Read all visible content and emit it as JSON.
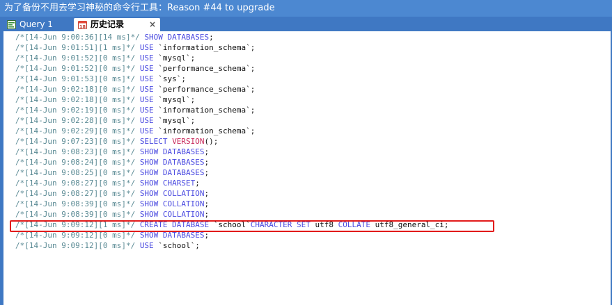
{
  "window": {
    "title": "为了备份不用去学习神秘的命令行工具：Reason #44 to upgrade"
  },
  "tabs": [
    {
      "label": "Query 1",
      "icon": "query-icon",
      "active": false
    },
    {
      "label": "历史记录",
      "icon": "calendar-icon",
      "icon_text": "18",
      "active": true
    }
  ],
  "add_tab_label": "+",
  "close_tab_label": "×",
  "history": [
    {
      "comment": "/*[14-Jun 9:00:36][14 ms]*/",
      "sql": [
        {
          "t": "k",
          "v": "SHOW DATABASES"
        },
        {
          "t": "s",
          "v": ";"
        }
      ]
    },
    {
      "comment": "/*[14-Jun 9:01:51][1 ms]*/",
      "sql": [
        {
          "t": "k",
          "v": "USE"
        },
        {
          "t": "s",
          "v": " `information_schema`;"
        }
      ]
    },
    {
      "comment": "/*[14-Jun 9:01:52][0 ms]*/",
      "sql": [
        {
          "t": "k",
          "v": "USE"
        },
        {
          "t": "s",
          "v": " `mysql`;"
        }
      ]
    },
    {
      "comment": "/*[14-Jun 9:01:52][0 ms]*/",
      "sql": [
        {
          "t": "k",
          "v": "USE"
        },
        {
          "t": "s",
          "v": " `performance_schema`;"
        }
      ]
    },
    {
      "comment": "/*[14-Jun 9:01:53][0 ms]*/",
      "sql": [
        {
          "t": "k",
          "v": "USE"
        },
        {
          "t": "s",
          "v": " `sys`;"
        }
      ]
    },
    {
      "comment": "/*[14-Jun 9:02:18][0 ms]*/",
      "sql": [
        {
          "t": "k",
          "v": "USE"
        },
        {
          "t": "s",
          "v": " `performance_schema`;"
        }
      ]
    },
    {
      "comment": "/*[14-Jun 9:02:18][0 ms]*/",
      "sql": [
        {
          "t": "k",
          "v": "USE"
        },
        {
          "t": "s",
          "v": " `mysql`;"
        }
      ]
    },
    {
      "comment": "/*[14-Jun 9:02:19][0 ms]*/",
      "sql": [
        {
          "t": "k",
          "v": "USE"
        },
        {
          "t": "s",
          "v": " `information_schema`;"
        }
      ]
    },
    {
      "comment": "/*[14-Jun 9:02:28][0 ms]*/",
      "sql": [
        {
          "t": "k",
          "v": "USE"
        },
        {
          "t": "s",
          "v": " `mysql`;"
        }
      ]
    },
    {
      "comment": "/*[14-Jun 9:02:29][0 ms]*/",
      "sql": [
        {
          "t": "k",
          "v": "USE"
        },
        {
          "t": "s",
          "v": " `information_schema`;"
        }
      ]
    },
    {
      "comment": "/*[14-Jun 9:07:23][0 ms]*/",
      "sql": [
        {
          "t": "k",
          "v": "SELECT"
        },
        {
          "t": "s",
          "v": " "
        },
        {
          "t": "f",
          "v": "VERSION"
        },
        {
          "t": "s",
          "v": "();"
        }
      ]
    },
    {
      "comment": "/*[14-Jun 9:08:23][0 ms]*/",
      "sql": [
        {
          "t": "k",
          "v": "SHOW DATABASES"
        },
        {
          "t": "s",
          "v": ";"
        }
      ]
    },
    {
      "comment": "/*[14-Jun 9:08:24][0 ms]*/",
      "sql": [
        {
          "t": "k",
          "v": "SHOW DATABASES"
        },
        {
          "t": "s",
          "v": ";"
        }
      ]
    },
    {
      "comment": "/*[14-Jun 9:08:25][0 ms]*/",
      "sql": [
        {
          "t": "k",
          "v": "SHOW DATABASES"
        },
        {
          "t": "s",
          "v": ";"
        }
      ]
    },
    {
      "comment": "/*[14-Jun 9:08:27][0 ms]*/",
      "sql": [
        {
          "t": "k",
          "v": "SHOW CHARSET"
        },
        {
          "t": "s",
          "v": ";"
        }
      ]
    },
    {
      "comment": "/*[14-Jun 9:08:27][0 ms]*/",
      "sql": [
        {
          "t": "k",
          "v": "SHOW COLLATION"
        },
        {
          "t": "s",
          "v": ";"
        }
      ]
    },
    {
      "comment": "/*[14-Jun 9:08:39][0 ms]*/",
      "sql": [
        {
          "t": "k",
          "v": "SHOW COLLATION"
        },
        {
          "t": "s",
          "v": ";"
        }
      ]
    },
    {
      "comment": "/*[14-Jun 9:08:39][0 ms]*/",
      "sql": [
        {
          "t": "k",
          "v": "SHOW COLLATION"
        },
        {
          "t": "s",
          "v": ";"
        }
      ]
    },
    {
      "comment": "/*[14-Jun 9:09:12][1 ms]*/",
      "highlighted": true,
      "sql": [
        {
          "t": "k",
          "v": "CREATE DATABASE"
        },
        {
          "t": "s",
          "v": " `school`"
        },
        {
          "t": "k",
          "v": "CHARACTER SET"
        },
        {
          "t": "s",
          "v": " utf8 "
        },
        {
          "t": "k",
          "v": "COLLATE"
        },
        {
          "t": "s",
          "v": " utf8_general_ci;"
        }
      ]
    },
    {
      "comment": "/*[14-Jun 9:09:12][0 ms]*/",
      "sql": [
        {
          "t": "k",
          "v": "SHOW DATABASES"
        },
        {
          "t": "s",
          "v": ";"
        }
      ]
    },
    {
      "comment": "/*[14-Jun 9:09:12][0 ms]*/",
      "sql": [
        {
          "t": "k",
          "v": "USE"
        },
        {
          "t": "s",
          "v": " `school`;"
        }
      ]
    }
  ],
  "colors": {
    "title_bg": "#4c88d1",
    "tab_bg": "#3f78c3",
    "comment": "#5a8a94",
    "keyword": "#4b4be0",
    "function": "#c8285a",
    "highlight_border": "#e21b1b"
  }
}
